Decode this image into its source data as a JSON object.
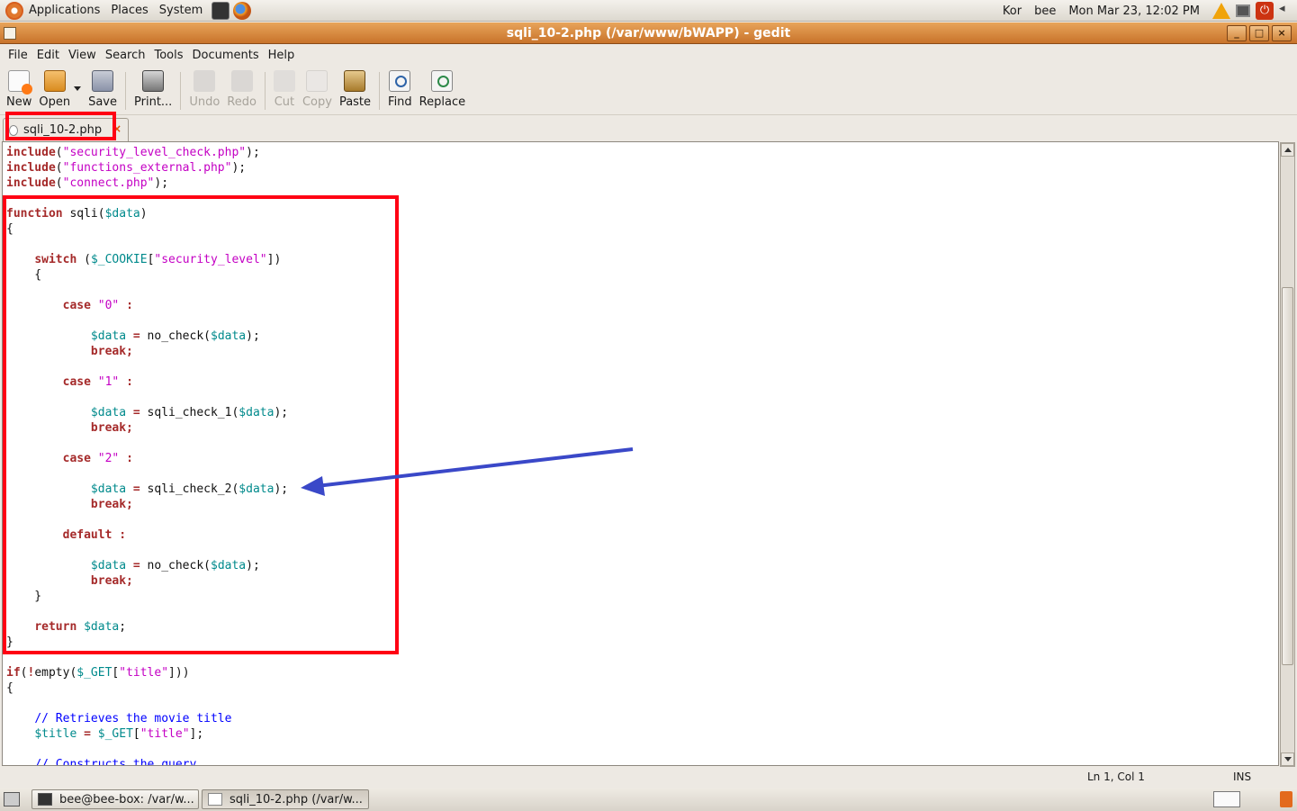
{
  "top_panel": {
    "menus": [
      "Applications",
      "Places",
      "System"
    ],
    "keyboard": "Kor",
    "user": "bee",
    "clock": "Mon Mar 23, 12:02 PM"
  },
  "window": {
    "title": "sqli_10-2.php (/var/www/bWAPP) - gedit",
    "controls": [
      "_",
      "□",
      "×"
    ]
  },
  "menubar": {
    "file": "File",
    "edit": "Edit",
    "view": "View",
    "search": "Search",
    "tools": "Tools",
    "documents": "Documents",
    "help": "Help"
  },
  "toolbar": {
    "new": "New",
    "open": "Open",
    "save": "Save",
    "print": "Print...",
    "undo": "Undo",
    "redo": "Redo",
    "cut": "Cut",
    "copy": "Copy",
    "paste": "Paste",
    "find": "Find",
    "replace": "Replace"
  },
  "tab": {
    "label": "sqli_10-2.php",
    "close": "×"
  },
  "status": {
    "position": "Ln 1, Col 1",
    "mode": "INS"
  },
  "taskbar": {
    "terminal": "bee@bee-box: /var/w...",
    "gedit": "sqli_10-2.php (/var/w..."
  },
  "annotation_colors": {
    "highlight_box": "#ff0013",
    "arrow": "#3a48c8"
  },
  "code_lines": [
    [
      [
        "kw",
        "include"
      ],
      [
        "pl",
        "("
      ],
      [
        "str",
        "\"security_level_check.php\""
      ],
      [
        "pl",
        ");"
      ]
    ],
    [
      [
        "kw",
        "include"
      ],
      [
        "pl",
        "("
      ],
      [
        "str",
        "\"functions_external.php\""
      ],
      [
        "pl",
        ");"
      ]
    ],
    [
      [
        "kw",
        "include"
      ],
      [
        "pl",
        "("
      ],
      [
        "str",
        "\"connect.php\""
      ],
      [
        "pl",
        ");"
      ]
    ],
    [],
    [
      [
        "kw",
        "function"
      ],
      [
        "pl",
        " sqli("
      ],
      [
        "var",
        "$data"
      ],
      [
        "pl",
        ")"
      ]
    ],
    [
      [
        "pl",
        "{"
      ]
    ],
    [],
    [
      [
        "pl",
        "    "
      ],
      [
        "kw",
        "switch"
      ],
      [
        "pl",
        " ("
      ],
      [
        "var",
        "$_COOKIE"
      ],
      [
        "pl",
        "["
      ],
      [
        "str",
        "\"security_level\""
      ],
      [
        "pl",
        "])"
      ]
    ],
    [
      [
        "pl",
        "    {"
      ]
    ],
    [],
    [
      [
        "pl",
        "        "
      ],
      [
        "kw",
        "case"
      ],
      [
        "pl",
        " "
      ],
      [
        "str",
        "\"0\""
      ],
      [
        "pl",
        " "
      ],
      [
        "kw",
        ":"
      ]
    ],
    [],
    [
      [
        "pl",
        "            "
      ],
      [
        "var",
        "$data"
      ],
      [
        "pl",
        " "
      ],
      [
        "kw",
        "="
      ],
      [
        "pl",
        " no_check("
      ],
      [
        "var",
        "$data"
      ],
      [
        "pl",
        ");"
      ]
    ],
    [
      [
        "pl",
        "            "
      ],
      [
        "kw",
        "break;"
      ]
    ],
    [],
    [
      [
        "pl",
        "        "
      ],
      [
        "kw",
        "case"
      ],
      [
        "pl",
        " "
      ],
      [
        "str",
        "\"1\""
      ],
      [
        "pl",
        " "
      ],
      [
        "kw",
        ":"
      ]
    ],
    [],
    [
      [
        "pl",
        "            "
      ],
      [
        "var",
        "$data"
      ],
      [
        "pl",
        " "
      ],
      [
        "kw",
        "="
      ],
      [
        "pl",
        " sqli_check_1("
      ],
      [
        "var",
        "$data"
      ],
      [
        "pl",
        ");"
      ]
    ],
    [
      [
        "pl",
        "            "
      ],
      [
        "kw",
        "break;"
      ]
    ],
    [],
    [
      [
        "pl",
        "        "
      ],
      [
        "kw",
        "case"
      ],
      [
        "pl",
        " "
      ],
      [
        "str",
        "\"2\""
      ],
      [
        "pl",
        " "
      ],
      [
        "kw",
        ":"
      ]
    ],
    [],
    [
      [
        "pl",
        "            "
      ],
      [
        "var",
        "$data"
      ],
      [
        "pl",
        " "
      ],
      [
        "kw",
        "="
      ],
      [
        "pl",
        " sqli_check_2("
      ],
      [
        "var",
        "$data"
      ],
      [
        "pl",
        ");"
      ]
    ],
    [
      [
        "pl",
        "            "
      ],
      [
        "kw",
        "break;"
      ]
    ],
    [],
    [
      [
        "pl",
        "        "
      ],
      [
        "kw",
        "default"
      ],
      [
        "pl",
        " "
      ],
      [
        "kw",
        ":"
      ]
    ],
    [],
    [
      [
        "pl",
        "            "
      ],
      [
        "var",
        "$data"
      ],
      [
        "pl",
        " "
      ],
      [
        "kw",
        "="
      ],
      [
        "pl",
        " no_check("
      ],
      [
        "var",
        "$data"
      ],
      [
        "pl",
        ");"
      ]
    ],
    [
      [
        "pl",
        "            "
      ],
      [
        "kw",
        "break;"
      ]
    ],
    [
      [
        "pl",
        "    }"
      ]
    ],
    [],
    [
      [
        "pl",
        "    "
      ],
      [
        "kw",
        "return"
      ],
      [
        "pl",
        " "
      ],
      [
        "var",
        "$data"
      ],
      [
        "pl",
        ";"
      ]
    ],
    [
      [
        "pl",
        "}"
      ]
    ],
    [],
    [
      [
        "kw",
        "if"
      ],
      [
        "pl",
        "("
      ],
      [
        "kw",
        "!"
      ],
      [
        "pl",
        "empty("
      ],
      [
        "var",
        "$_GET"
      ],
      [
        "pl",
        "["
      ],
      [
        "str",
        "\"title\""
      ],
      [
        "pl",
        "]))"
      ]
    ],
    [
      [
        "pl",
        "{"
      ]
    ],
    [],
    [
      [
        "pl",
        "    "
      ],
      [
        "com",
        "// Retrieves the movie title"
      ]
    ],
    [
      [
        "pl",
        "    "
      ],
      [
        "var",
        "$title"
      ],
      [
        "pl",
        " "
      ],
      [
        "kw",
        "="
      ],
      [
        "pl",
        " "
      ],
      [
        "var",
        "$_GET"
      ],
      [
        "pl",
        "["
      ],
      [
        "str",
        "\"title\""
      ],
      [
        "pl",
        "];"
      ]
    ],
    [],
    [
      [
        "pl",
        "    "
      ],
      [
        "com",
        "// Constructs the query"
      ]
    ]
  ]
}
